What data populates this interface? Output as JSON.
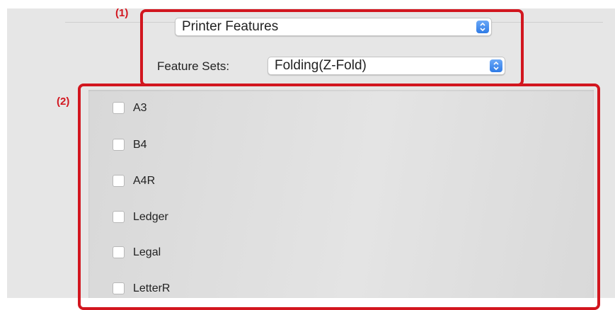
{
  "callouts": {
    "one": "(1)",
    "two": "(2)"
  },
  "popups": {
    "panel_selector": {
      "value": "Printer Features"
    },
    "feature_sets": {
      "label": "Feature Sets:",
      "value": "Folding(Z-Fold)"
    }
  },
  "options": [
    {
      "label": "A3",
      "checked": false
    },
    {
      "label": "B4",
      "checked": false
    },
    {
      "label": "A4R",
      "checked": false
    },
    {
      "label": "Ledger",
      "checked": false
    },
    {
      "label": "Legal",
      "checked": false
    },
    {
      "label": "LetterR",
      "checked": false
    }
  ],
  "colors": {
    "callout": "#d2161f",
    "stepper": "#3d86ee"
  },
  "icons": {
    "stepper": "up-down-chevron-icon"
  }
}
